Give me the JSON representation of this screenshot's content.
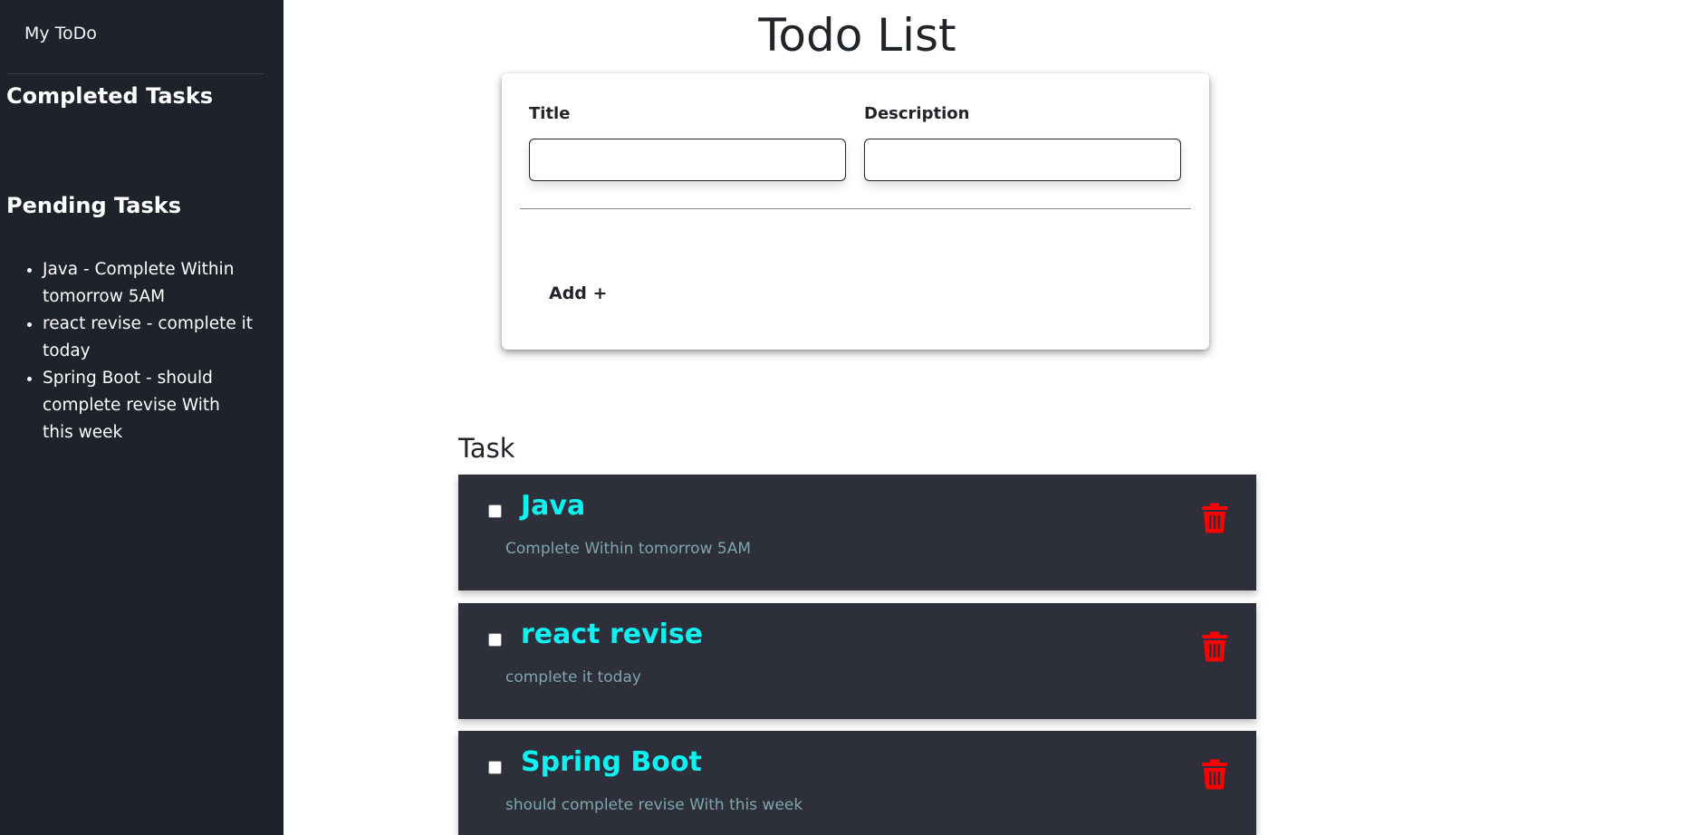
{
  "sidebar": {
    "brand": "My ToDo",
    "completed_heading": "Completed Tasks",
    "pending_heading": "Pending Tasks",
    "pending_items": [
      "Java - Complete Within tomorrow 5AM",
      "react revise - complete it today",
      "Spring Boot - should complete revise With this week"
    ]
  },
  "main": {
    "title": "Todo List",
    "form": {
      "title_label": "Title",
      "title_value": "",
      "description_label": "Description",
      "description_value": "",
      "add_label": "Add +"
    },
    "task_heading": "Task",
    "tasks": [
      {
        "title": "Java",
        "description": "Complete Within tomorrow 5AM",
        "checked": false
      },
      {
        "title": "react revise",
        "description": "complete it today",
        "checked": false
      },
      {
        "title": "Spring Boot",
        "description": "should complete revise With this week",
        "checked": false
      }
    ]
  },
  "colors": {
    "sidebar_bg": "#1e222b",
    "task_card_bg": "#2d2f3b",
    "task_title": "#0ff0f0",
    "task_desc": "#7fa7a9",
    "delete_icon": "#ff0000"
  },
  "icons": {
    "delete": "trash-icon"
  }
}
